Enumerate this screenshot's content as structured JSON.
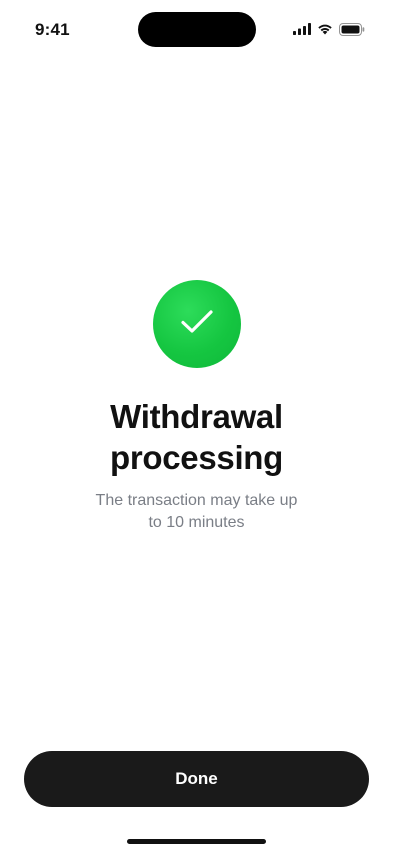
{
  "status_bar": {
    "time": "9:41",
    "icons": [
      "cellular-signal-icon",
      "wifi-icon",
      "battery-icon"
    ]
  },
  "success": {
    "icon": "checkmark-icon",
    "accent_color": "#16C742",
    "title": "Withdrawal processing",
    "subtitle": "The transaction may take up to 10 minutes"
  },
  "actions": {
    "done_label": "Done"
  }
}
